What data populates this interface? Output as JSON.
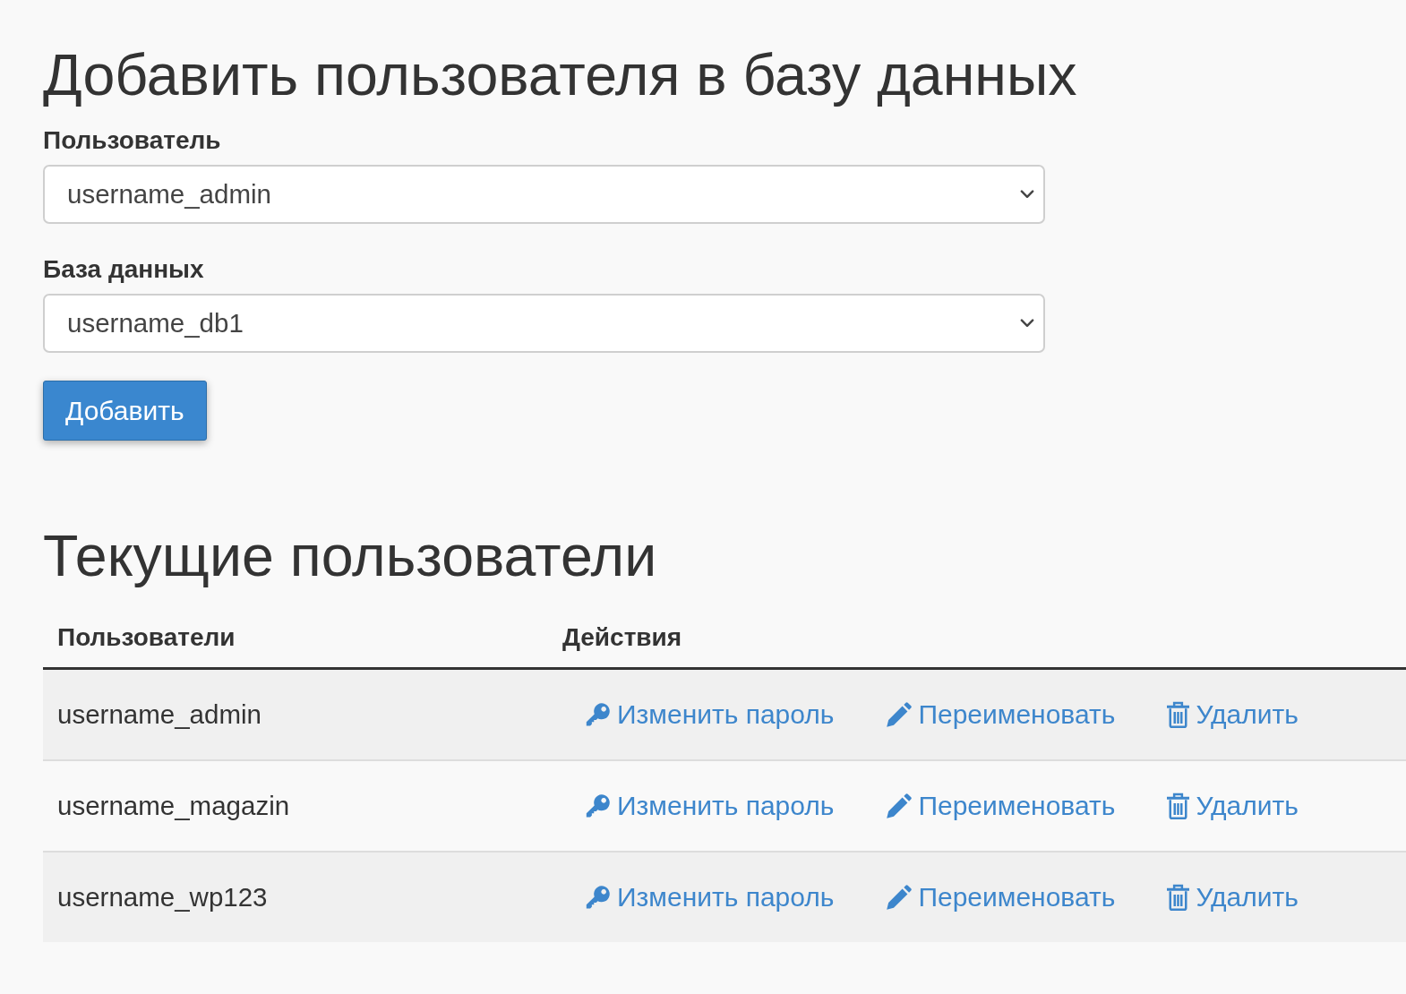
{
  "add_form": {
    "title": "Добавить пользователя в базу данных",
    "fields": [
      {
        "label": "Пользователь",
        "value": "username_admin"
      },
      {
        "label": "База данных",
        "value": "username_db1"
      }
    ],
    "submit_button": "Добавить"
  },
  "users_table": {
    "title": "Текущие пользователи",
    "columns": [
      "Пользователи",
      "Действия"
    ],
    "rows": [
      {
        "user": "username_admin",
        "actions": [
          {
            "kind": "change_password",
            "label": "Изменить пароль"
          },
          {
            "kind": "rename",
            "label": "Переименовать"
          },
          {
            "kind": "delete",
            "label": "Удалить"
          }
        ]
      },
      {
        "user": "username_magazin",
        "actions": [
          {
            "kind": "change_password",
            "label": "Изменить пароль"
          },
          {
            "kind": "rename",
            "label": "Переименовать"
          },
          {
            "kind": "delete",
            "label": "Удалить"
          }
        ]
      },
      {
        "user": "username_wp123",
        "actions": [
          {
            "kind": "change_password",
            "label": "Изменить пароль"
          },
          {
            "kind": "rename",
            "label": "Переименовать"
          },
          {
            "kind": "delete",
            "label": "Удалить"
          }
        ]
      }
    ]
  }
}
